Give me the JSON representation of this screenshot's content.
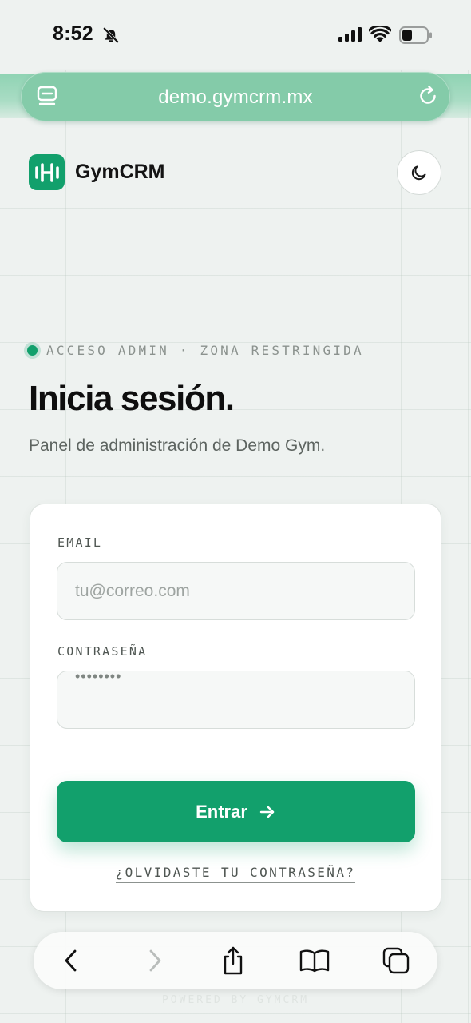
{
  "status_bar": {
    "time": "8:52"
  },
  "browser": {
    "url": "demo.gymcrm.mx"
  },
  "brand": {
    "name": "GymCRM",
    "accent": "#12a06c"
  },
  "hero": {
    "eyebrow": "ACCESO ADMIN · ZONA RESTRINGIDA",
    "title": "Inicia sesión.",
    "subtitle": "Panel de administración de Demo Gym."
  },
  "form": {
    "email_label": "EMAIL",
    "email_placeholder": "tu@correo.com",
    "password_label": "CONTRASEÑA",
    "password_value": "••••••••",
    "submit_label": "Entrar",
    "forgot_label": "¿OLVIDASTE TU CONTRASEÑA?"
  },
  "footer": {
    "text": "POWERED BY GYMCRM"
  },
  "icons": [
    "bell-off-icon",
    "signal-icon",
    "wifi-icon",
    "battery-icon",
    "tabs-overview-icon",
    "reload-icon",
    "dumbbell-icon",
    "moon-icon",
    "arrow-right-icon",
    "back-icon",
    "forward-icon",
    "share-icon",
    "bookmarks-icon",
    "tabs-icon"
  ]
}
